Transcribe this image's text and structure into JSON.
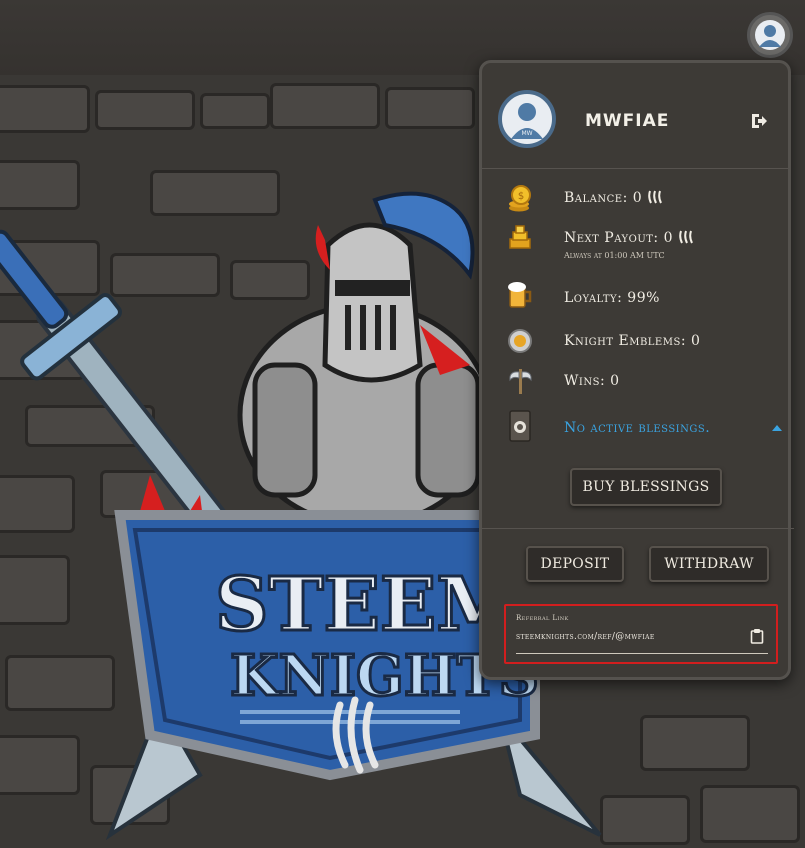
{
  "user": {
    "username": "MWFIAE",
    "avatar_initials": "MW"
  },
  "stats": {
    "balance_label": "Balance: 0",
    "next_payout_label": "Next Payout: 0",
    "next_payout_note": "Always at 01:00 AM UTC",
    "loyalty_label": "Loyalty: 99%",
    "emblems_label": "Knight Emblems: 0",
    "wins_label": "Wins: 0",
    "blessings_label": "No active blessings."
  },
  "buttons": {
    "buy_blessings": "BUY BLESSINGS",
    "deposit": "DEPOSIT",
    "withdraw": "WITHDRAW"
  },
  "referral": {
    "label": "Referral Link",
    "value": "steemknights.com/ref/@mwfiae"
  },
  "logo": {
    "line1": "STEEM",
    "line2": "KNIGHTS"
  },
  "colors": {
    "accent_blue": "#3aa3e0",
    "highlight_red": "#d21e1e",
    "panel_bg": "#3d3a36"
  },
  "icons": {
    "currency": "steem-icon",
    "balance": "coin-stack-icon",
    "payout": "gold-bars-icon",
    "loyalty": "beer-mug-icon",
    "emblems": "emblem-coin-icon",
    "wins": "battle-axe-icon",
    "blessings": "blessing-book-icon",
    "logout": "logout-icon",
    "copy": "clipboard-icon"
  }
}
